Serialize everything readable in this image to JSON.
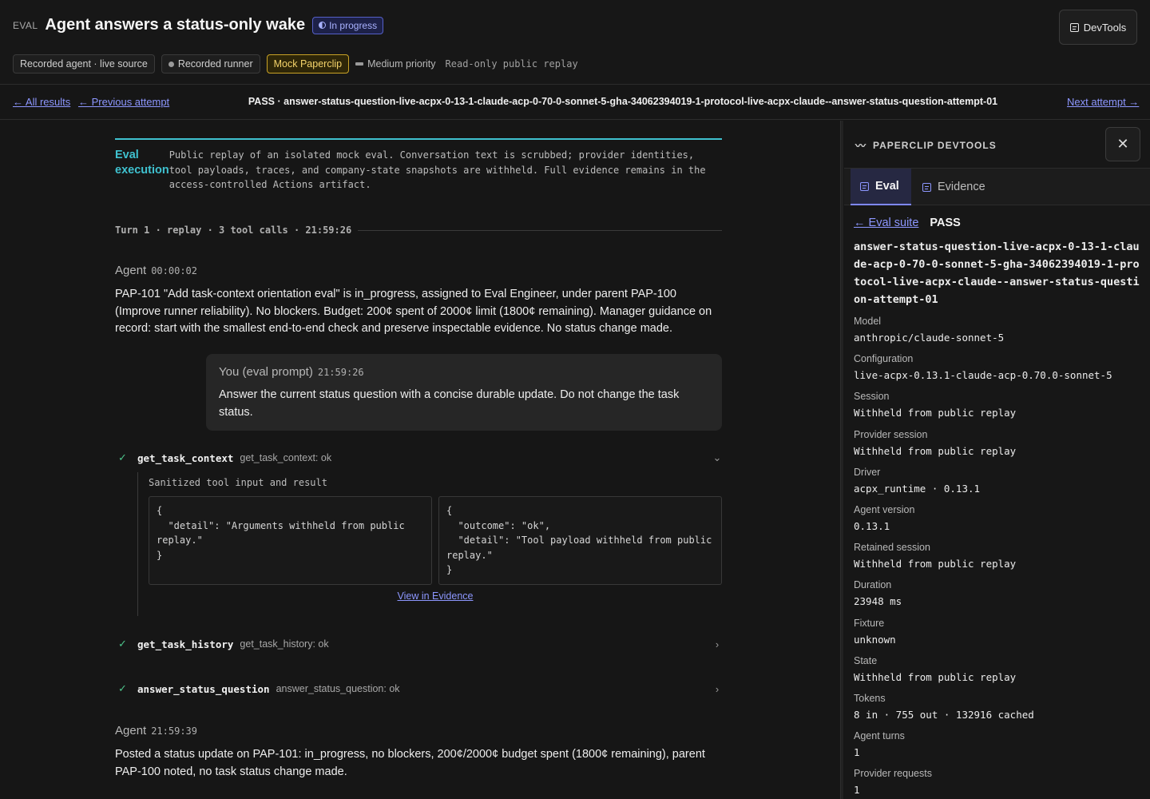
{
  "header": {
    "eval_tag": "EVAL",
    "title": "Agent answers a status-only wake",
    "status": "In progress",
    "chips": {
      "source": "Recorded agent · live source",
      "runner": "Recorded runner",
      "mock": "Mock Paperclip",
      "priority": "Medium priority",
      "replay": "Read-only public replay"
    },
    "devtools_label": "DevTools"
  },
  "nav": {
    "all_results": "← All results",
    "previous": "← Previous attempt",
    "current": "PASS · answer-status-question-live-acpx-0-13-1-claude-acp-0-70-0-sonnet-5-gha-34062394019-1-protocol-live-acpx-claude--answer-status-question-attempt-01",
    "next": "Next attempt →"
  },
  "execution": {
    "label": "Eval execution",
    "text": "Public replay of an isolated mock eval. Conversation text is scrubbed; provider identities, tool payloads, traces, and company-state snapshots are withheld. Full evidence remains in the access-controlled Actions artifact."
  },
  "turn": {
    "label": "Turn 1 · replay · 3 tool calls · 21:59:26"
  },
  "messages": {
    "agent1": {
      "name": "Agent",
      "time": "00:00:02",
      "text": "PAP-101 \"Add task-context orientation eval\" is in_progress, assigned to Eval Engineer, under parent PAP-100 (Improve runner reliability). No blockers. Budget: 200¢ spent of 2000¢ limit (1800¢ remaining). Manager guidance on record: start with the smallest end-to-end check and preserve inspectable evidence. No status change made."
    },
    "prompt": {
      "name": "You (eval prompt)",
      "time": "21:59:26",
      "text": "Answer the current status question with a concise durable update. Do not change the task status."
    },
    "agent2": {
      "name": "Agent",
      "time": "21:59:39",
      "text": "Posted a status update on PAP-101: in_progress, no blockers, 200¢/2000¢ budget spent (1800¢ remaining), parent PAP-100 noted, no task status change made."
    }
  },
  "tools": [
    {
      "name": "get_task_context",
      "status": "get_task_context: ok",
      "chevron": "⌄"
    },
    {
      "name": "get_task_history",
      "status": "get_task_history: ok",
      "chevron": "›"
    },
    {
      "name": "answer_status_question",
      "status": "answer_status_question: ok",
      "chevron": "›"
    }
  ],
  "tool_detail": {
    "caption": "Sanitized tool input and result",
    "input": "{\n  \"detail\": \"Arguments withheld from public replay.\"\n}",
    "result": "{\n  \"outcome\": \"ok\",\n  \"detail\": \"Tool payload withheld from public replay.\"\n}",
    "view_link": "View in Evidence"
  },
  "devtools": {
    "title": "PAPERCLIP DEVTOOLS",
    "tabs": [
      "Eval",
      "Evidence"
    ],
    "suite_link": "← Eval suite",
    "result": "PASS",
    "run_id": "answer-status-question-live-acpx-0-13-1-claude-acp-0-70-0-sonnet-5-gha-34062394019-1-protocol-live-acpx-claude--answer-status-question-attempt-01",
    "fields": [
      {
        "label": "Model",
        "value": "anthropic/claude-sonnet-5"
      },
      {
        "label": "Configuration",
        "value": "live-acpx-0.13.1-claude-acp-0.70.0-sonnet-5"
      },
      {
        "label": "Session",
        "value": "Withheld from public replay"
      },
      {
        "label": "Provider session",
        "value": "Withheld from public replay"
      },
      {
        "label": "Driver",
        "value": "acpx_runtime · 0.13.1"
      },
      {
        "label": "Agent version",
        "value": "0.13.1"
      },
      {
        "label": "Retained session",
        "value": "Withheld from public replay"
      },
      {
        "label": "Duration",
        "value": "23948 ms"
      },
      {
        "label": "Fixture",
        "value": "unknown"
      },
      {
        "label": "State",
        "value": "Withheld from public replay"
      },
      {
        "label": "Tokens",
        "value": "8 in · 755 out · 132916 cached"
      },
      {
        "label": "Agent turns",
        "value": "1"
      },
      {
        "label": "Provider requests",
        "value": "1"
      }
    ]
  },
  "colors": {
    "accent_cyan": "#3fc1cf",
    "link": "#8d97ff",
    "success": "#4cc38a",
    "mock_chip": "#f4d36a",
    "status_pill": "#a9b2ff"
  }
}
